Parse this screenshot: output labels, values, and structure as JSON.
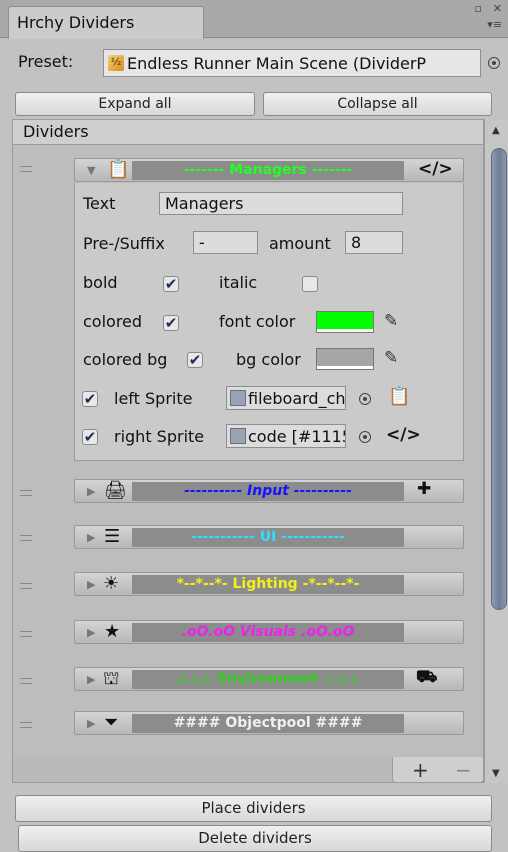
{
  "window": {
    "tab_title": "Hrchy Dividers"
  },
  "preset": {
    "label": "Preset:",
    "value": "Endless Runner Main Scene (DividerP",
    "icon": "scriptable-object-icon"
  },
  "toolbar": {
    "expand_label": "Expand all",
    "collapse_label": "Collapse all"
  },
  "list": {
    "header": "Dividers"
  },
  "dividers": [
    {
      "text": "------- Managers -------",
      "color": "#22ff22",
      "bg": "#8c8c8c",
      "icon": "clipboard-icon",
      "right_icon": "code-icon",
      "expanded": true
    },
    {
      "text": "---------- Input ----------",
      "color": "#1414ff",
      "bg": "#8c8c8c",
      "icon": "print-icon",
      "right_icon": "dpad-icon",
      "expanded": false
    },
    {
      "text": "----------- UI -----------",
      "color": "#33ddff",
      "bg": "#8c8c8c",
      "icon": "list-icon",
      "right_icon": "",
      "expanded": false
    },
    {
      "text": "*--*--*- Lighting -*--*--*-",
      "color": "#f5f01a",
      "bg": "#8c8c8c",
      "icon": "sun-icon",
      "right_icon": "",
      "expanded": false
    },
    {
      "text": ".oO.oO Visuals .oO.oO",
      "color": "#ee22ee",
      "bg": "#8c8c8c",
      "icon": "star-icon",
      "right_icon": "",
      "expanded": false
    },
    {
      "text": ".:.:.:. Environment .:.:.:.",
      "color": "#33cc22",
      "bg": "#8c8c8c",
      "icon": "building-icon",
      "right_icon": "truck-icon",
      "expanded": false
    },
    {
      "text": "#### Objectpool ####",
      "color": "#f0f0f0",
      "bg": "#8c8c8c",
      "icon": "filter-icon",
      "right_icon": "",
      "expanded": false
    }
  ],
  "editor": {
    "text_label": "Text",
    "text_value": "Managers",
    "prefix_label": "Pre-/Suffix",
    "prefix_value": "-",
    "amount_label": "amount",
    "amount_value": "8",
    "bold_label": "bold",
    "bold_checked": true,
    "italic_label": "italic",
    "italic_checked": false,
    "colored_label": "colored",
    "colored_checked": true,
    "font_color_label": "font color",
    "font_color": "#00ff00",
    "colored_bg_label": "colored bg",
    "colored_bg_checked": true,
    "bg_color_label": "bg color",
    "bg_color": "#a6a6a6",
    "left_sprite_label": "left Sprite",
    "left_sprite_checked": true,
    "left_sprite_value": "fileboard_che",
    "right_sprite_label": "right Sprite",
    "right_sprite_checked": true,
    "right_sprite_value": "code [#1115"
  },
  "footer": {
    "plus": "+",
    "minus": "−",
    "place_label": "Place dividers",
    "delete_label": "Delete dividers"
  }
}
